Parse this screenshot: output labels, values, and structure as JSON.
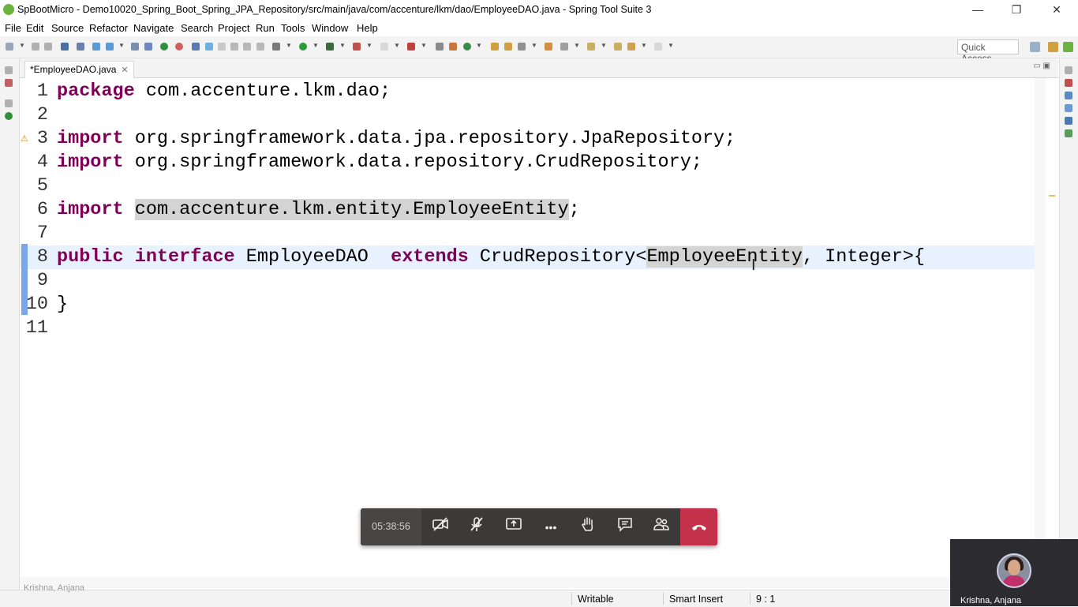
{
  "window": {
    "title": "SpBootMicro - Demo10020_Spring_Boot_Spring_JPA_Repository/src/main/java/com/accenture/lkm/dao/EmployeeDAO.java - Spring Tool Suite 3",
    "minimize_glyph": "—",
    "maximize_glyph": "❐",
    "close_glyph": "✕"
  },
  "menu": {
    "items": [
      "File",
      "Edit",
      "Source",
      "Refactor",
      "Navigate",
      "Search",
      "Project",
      "Run",
      "Tools",
      "Window",
      "Help"
    ]
  },
  "toolbar": {
    "quick_access": "Quick Access"
  },
  "editor": {
    "tab_label": "*EmployeeDAO.java",
    "tab_close": "✕",
    "ctrl_minimize": "▭",
    "ctrl_maximize": "▣",
    "lines": [
      {
        "num": "1",
        "tokens": [
          {
            "t": "package",
            "kw": true
          },
          {
            "t": " com.accenture.lkm.dao;"
          }
        ]
      },
      {
        "num": "2",
        "tokens": []
      },
      {
        "num": "3",
        "tokens": [
          {
            "t": "import",
            "kw": true
          },
          {
            "t": " org.springframework.data.jpa.repository.JpaRepository;"
          }
        ]
      },
      {
        "num": "4",
        "tokens": [
          {
            "t": "import",
            "kw": true
          },
          {
            "t": " org.springframework.data.repository.CrudRepository;"
          }
        ]
      },
      {
        "num": "5",
        "tokens": []
      },
      {
        "num": "6",
        "tokens": [
          {
            "t": "import",
            "kw": true
          },
          {
            "t": " "
          },
          {
            "t": "com.accenture.lkm.entity.EmployeeEntity",
            "hl": true
          },
          {
            "t": ";"
          }
        ]
      },
      {
        "num": "7",
        "tokens": []
      },
      {
        "num": "8",
        "tokens": [
          {
            "t": "public",
            "kw": true
          },
          {
            "t": " "
          },
          {
            "t": "interface",
            "kw": true
          },
          {
            "t": " EmployeeDAO  "
          },
          {
            "t": "extends",
            "kw": true
          },
          {
            "t": " CrudRepository<"
          },
          {
            "t": "EmployeeEntity",
            "hl": true
          },
          {
            "t": ", Integer>{"
          }
        ]
      },
      {
        "num": "9",
        "tokens": []
      },
      {
        "num": "10",
        "tokens": [
          {
            "t": "}"
          }
        ]
      },
      {
        "num": "11",
        "tokens": []
      }
    ]
  },
  "status": {
    "writable": "Writable",
    "insert_mode": "Smart Insert",
    "position": "9 : 1"
  },
  "teams": {
    "timer": "05:38:56",
    "participant_name": "Krishna, Anjana",
    "icons": {
      "camera": "camera-off-icon",
      "mic": "mic-off-icon",
      "share": "share-screen-icon",
      "more": "more-icon",
      "hand": "raise-hand-icon",
      "chat": "chat-icon",
      "people": "participants-icon",
      "hangup": "hang-up-icon"
    },
    "glyphs": {
      "more": "•••",
      "hangup": "☎"
    }
  },
  "ghost_label": "Krishna, Anjana"
}
